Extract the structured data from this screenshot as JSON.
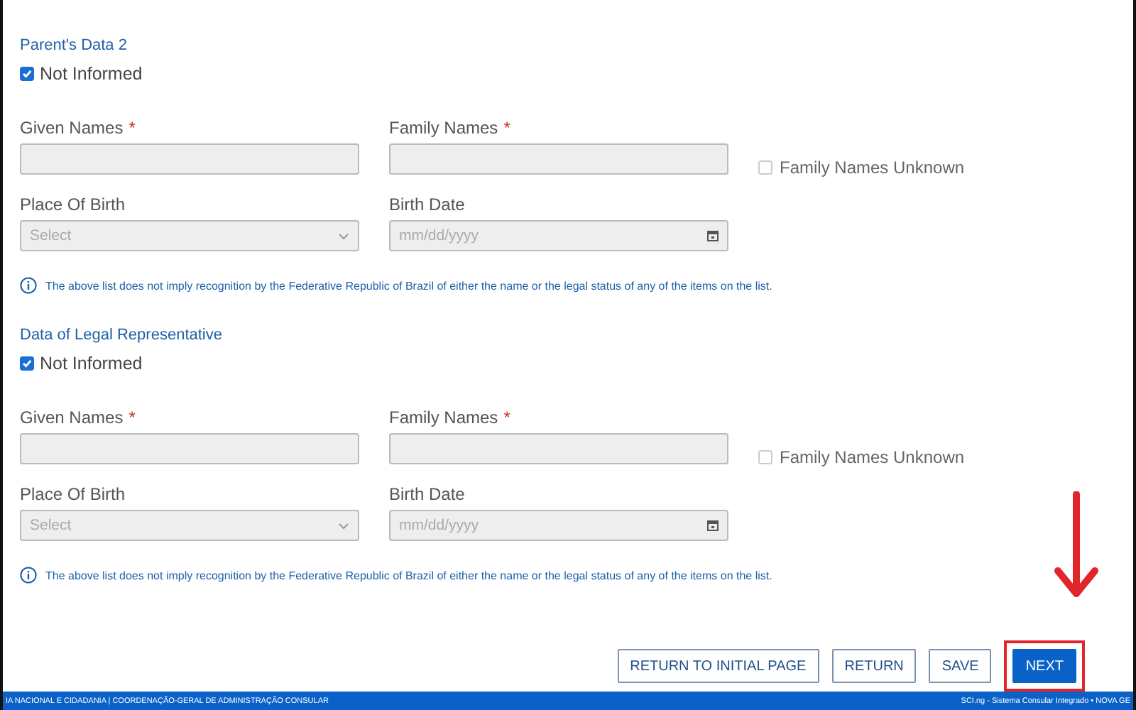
{
  "sections": [
    {
      "title": "Parent's Data 2",
      "not_informed": {
        "label": "Not Informed",
        "checked": true
      },
      "given_names": {
        "label": "Given Names",
        "required_mark": "*"
      },
      "family_names": {
        "label": "Family Names",
        "required_mark": "*"
      },
      "family_unknown": {
        "label": "Family Names Unknown",
        "checked": false
      },
      "place_of_birth": {
        "label": "Place Of Birth",
        "placeholder": "Select"
      },
      "birth_date": {
        "label": "Birth Date",
        "placeholder": "mm/dd/yyyy"
      },
      "notice": "The above list does not imply recognition by the Federative Republic of Brazil of either the name or the legal status of any of the items on the list."
    },
    {
      "title": "Data of Legal Representative",
      "not_informed": {
        "label": "Not Informed",
        "checked": true
      },
      "given_names": {
        "label": "Given Names",
        "required_mark": "*"
      },
      "family_names": {
        "label": "Family Names",
        "required_mark": "*"
      },
      "family_unknown": {
        "label": "Family Names Unknown",
        "checked": false
      },
      "place_of_birth": {
        "label": "Place Of Birth",
        "placeholder": "Select"
      },
      "birth_date": {
        "label": "Birth Date",
        "placeholder": "mm/dd/yyyy"
      },
      "notice": "The above list does not imply recognition by the Federative Republic of Brazil of either the name or the legal status of any of the items on the list."
    }
  ],
  "buttons": [
    {
      "label": "RETURN TO INITIAL PAGE",
      "kind": "outline"
    },
    {
      "label": "RETURN",
      "kind": "outline"
    },
    {
      "label": "SAVE",
      "kind": "outline"
    },
    {
      "label": "NEXT",
      "kind": "primary",
      "highlighted": true
    }
  ],
  "footer": {
    "left": "IA NACIONAL E CIDADANIA | COORDENAÇÃO-GERAL DE ADMINISTRAÇÃO CONSULAR",
    "right": "SCI.ng - Sistema Consular Integrado • NOVA GE"
  }
}
